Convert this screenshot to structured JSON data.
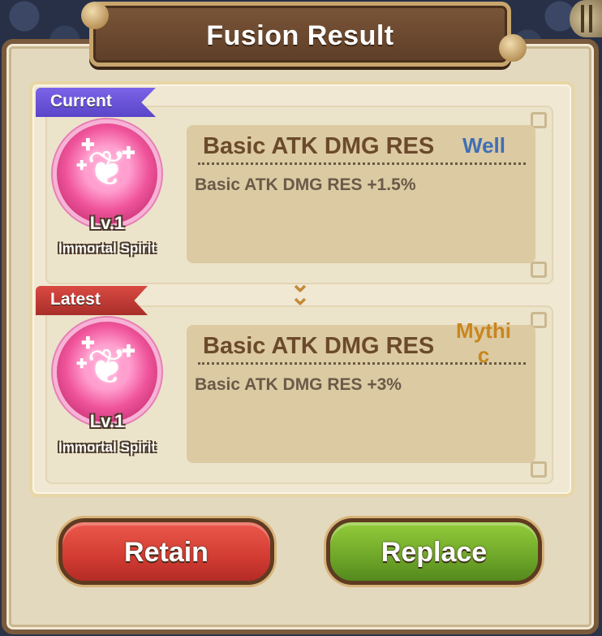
{
  "title": "Fusion Result",
  "current": {
    "ribbon": "Current",
    "level": "Lv.1",
    "spirit_name": "Immortal Spirit",
    "stat_title": "Basic ATK DMG RES",
    "rarity": "Well",
    "stat_desc": "Basic ATK DMG RES +1.5%"
  },
  "latest": {
    "ribbon": "Latest",
    "level": "Lv.1",
    "spirit_name": "Immortal Spirit",
    "stat_title": "Basic ATK DMG RES",
    "rarity_line1": "Mythi",
    "rarity_line2": "c",
    "stat_desc": "Basic ATK DMG RES +3%"
  },
  "buttons": {
    "retain": "Retain",
    "replace": "Replace"
  },
  "icons": {
    "spirit": "spirit-hands-icon",
    "arrow": "double-chevron-down-icon"
  },
  "colors": {
    "rarity_well": "#3f6fb5",
    "rarity_mythic": "#c9861d",
    "retain": "#d23b32",
    "replace": "#6ea629"
  }
}
